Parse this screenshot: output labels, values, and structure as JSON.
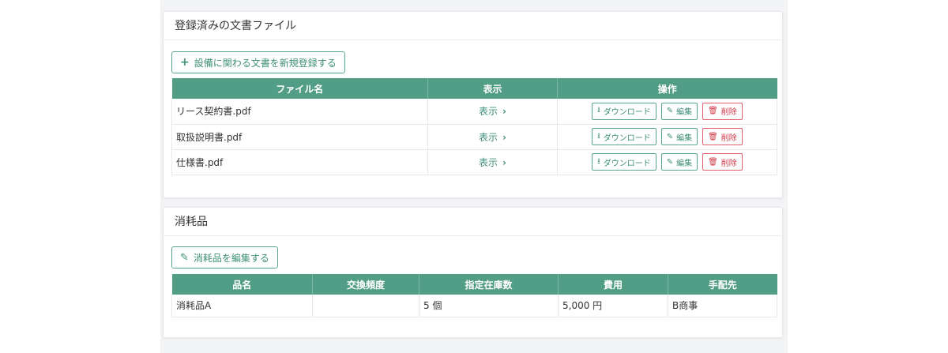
{
  "documents": {
    "title": "登録済みの文書ファイル",
    "add_button": "設備に関わる文書を新規登録する",
    "columns": [
      "ファイル名",
      "表示",
      "操作"
    ],
    "rows": [
      {
        "file": "リース契約書.pdf",
        "view": "表示"
      },
      {
        "file": "取扱説明書.pdf",
        "view": "表示"
      },
      {
        "file": "仕様書.pdf",
        "view": "表示"
      }
    ],
    "actions": {
      "download": "ダウンロード",
      "edit": "編集",
      "delete": "削除"
    }
  },
  "consumables": {
    "title": "消耗品",
    "edit_button": "消耗品を編集する",
    "columns": [
      "品名",
      "交換頻度",
      "指定在庫数",
      "費用",
      "手配先"
    ],
    "rows": [
      {
        "name": "消耗品A",
        "frequency": "",
        "stock": "5 個",
        "cost": "5,000 円",
        "supplier": "B商事"
      }
    ]
  },
  "colors": {
    "accent": "#529d86",
    "danger": "#d23a4b"
  }
}
